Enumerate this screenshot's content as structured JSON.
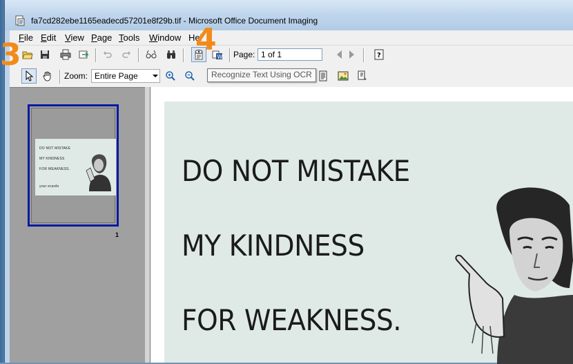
{
  "window": {
    "title": "fa7cd282ebe1165eadecd57201e8f29b.tif - Microsoft Office Document Imaging"
  },
  "menu": [
    {
      "label": "File",
      "key": "F",
      "rest": "ile"
    },
    {
      "label": "Edit",
      "key": "E",
      "rest": "dit"
    },
    {
      "label": "View",
      "key": "V",
      "rest": "iew"
    },
    {
      "label": "Page",
      "key": "P",
      "rest": "age"
    },
    {
      "label": "Tools",
      "key": "T",
      "rest": "ools"
    },
    {
      "label": "Window",
      "key": "W",
      "rest": "indow"
    },
    {
      "label": "Help",
      "key": "",
      "rest": "Hel"
    }
  ],
  "toolbar": {
    "page_label": "Page:",
    "page_value": "1 of 1",
    "zoom_label": "Zoom:",
    "zoom_value": "Entire Page",
    "tooltip": "Recognize Text Using OCR"
  },
  "thumbnail": {
    "lines": [
      "DO NOT MISTAKE",
      "MY KINDNESS",
      "FOR WEAKNESS."
    ],
    "brand": "your ecards",
    "page_number": "1"
  },
  "document": {
    "lines": [
      "DO NOT MISTAKE",
      "MY KINDNESS",
      "FOR WEAKNESS."
    ]
  },
  "annotations": {
    "step3": "3",
    "step4": "4"
  },
  "colors": {
    "annotation": "#f28b1a",
    "thumb_border": "#061aa0",
    "page_bg": "#dfeae6"
  }
}
